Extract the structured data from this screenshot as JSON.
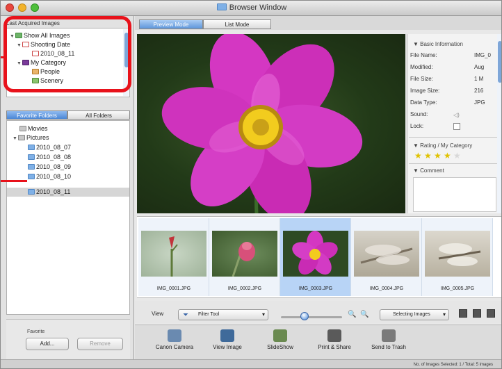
{
  "window": {
    "title": "Browser Window"
  },
  "left_panel": {
    "header": "Last Acquired Images",
    "tree_top": [
      {
        "label": "Show All Images"
      },
      {
        "label": "Shooting Date"
      },
      {
        "label": "2010_08_11"
      },
      {
        "label": "My Category"
      },
      {
        "label": "People"
      },
      {
        "label": "Scenery"
      }
    ],
    "tabs": [
      {
        "label": "Favorite Folders"
      },
      {
        "label": "All Folders"
      }
    ],
    "favorites": [
      {
        "label": "Movies"
      },
      {
        "label": "Pictures"
      },
      {
        "label": "2010_08_07"
      },
      {
        "label": "2010_08_08"
      },
      {
        "label": "2010_08_09"
      },
      {
        "label": "2010_08_10"
      },
      {
        "label": "2010_08_11"
      }
    ],
    "favorite_box": {
      "label": "Favorite",
      "add_button": "Add...",
      "remove_button": "Remove"
    }
  },
  "mode_tabs": [
    {
      "label": "Preview Mode"
    },
    {
      "label": "List Mode"
    }
  ],
  "info_panel": {
    "basic_header": "Basic Information",
    "rows": [
      {
        "label": "File Name:",
        "value": "IMG_0"
      },
      {
        "label": "Modified:",
        "value": "Aug"
      },
      {
        "label": "File Size:",
        "value": "1 M"
      },
      {
        "label": "Image Size:",
        "value": "216"
      },
      {
        "label": "Data Type:",
        "value": "JPG"
      },
      {
        "label": "Sound:",
        "value": ""
      },
      {
        "label": "Lock:",
        "value": ""
      }
    ],
    "rating_header": "Rating / My Category",
    "rating_stars": 4,
    "comment_header": "Comment"
  },
  "thumbnails": [
    {
      "name": "IMG_0001.JPG",
      "selected": false
    },
    {
      "name": "IMG_0002.JPG",
      "selected": false
    },
    {
      "name": "IMG_0003.JPG",
      "selected": true
    },
    {
      "name": "IMG_0004.JPG",
      "selected": false
    },
    {
      "name": "IMG_0005.JPG",
      "selected": false
    }
  ],
  "toolbar": {
    "view_label": "View",
    "filter_label": "Filter Tool",
    "selecting_label": "Selecting Images"
  },
  "actions": [
    {
      "label": "Canon Camera",
      "icon": "camera-icon"
    },
    {
      "label": "View Image",
      "icon": "image-icon"
    },
    {
      "label": "SlideShow",
      "icon": "slideshow-icon"
    },
    {
      "label": "Print & Share",
      "icon": "printer-icon"
    },
    {
      "label": "Send to Trash",
      "icon": "trash-icon"
    }
  ],
  "status": {
    "text": "No. of Images Selected: 1 / Total: 5 images"
  },
  "colors": {
    "accent": "#5e96da",
    "highlight": "#e8121b",
    "selection": "#b8d4f6"
  }
}
